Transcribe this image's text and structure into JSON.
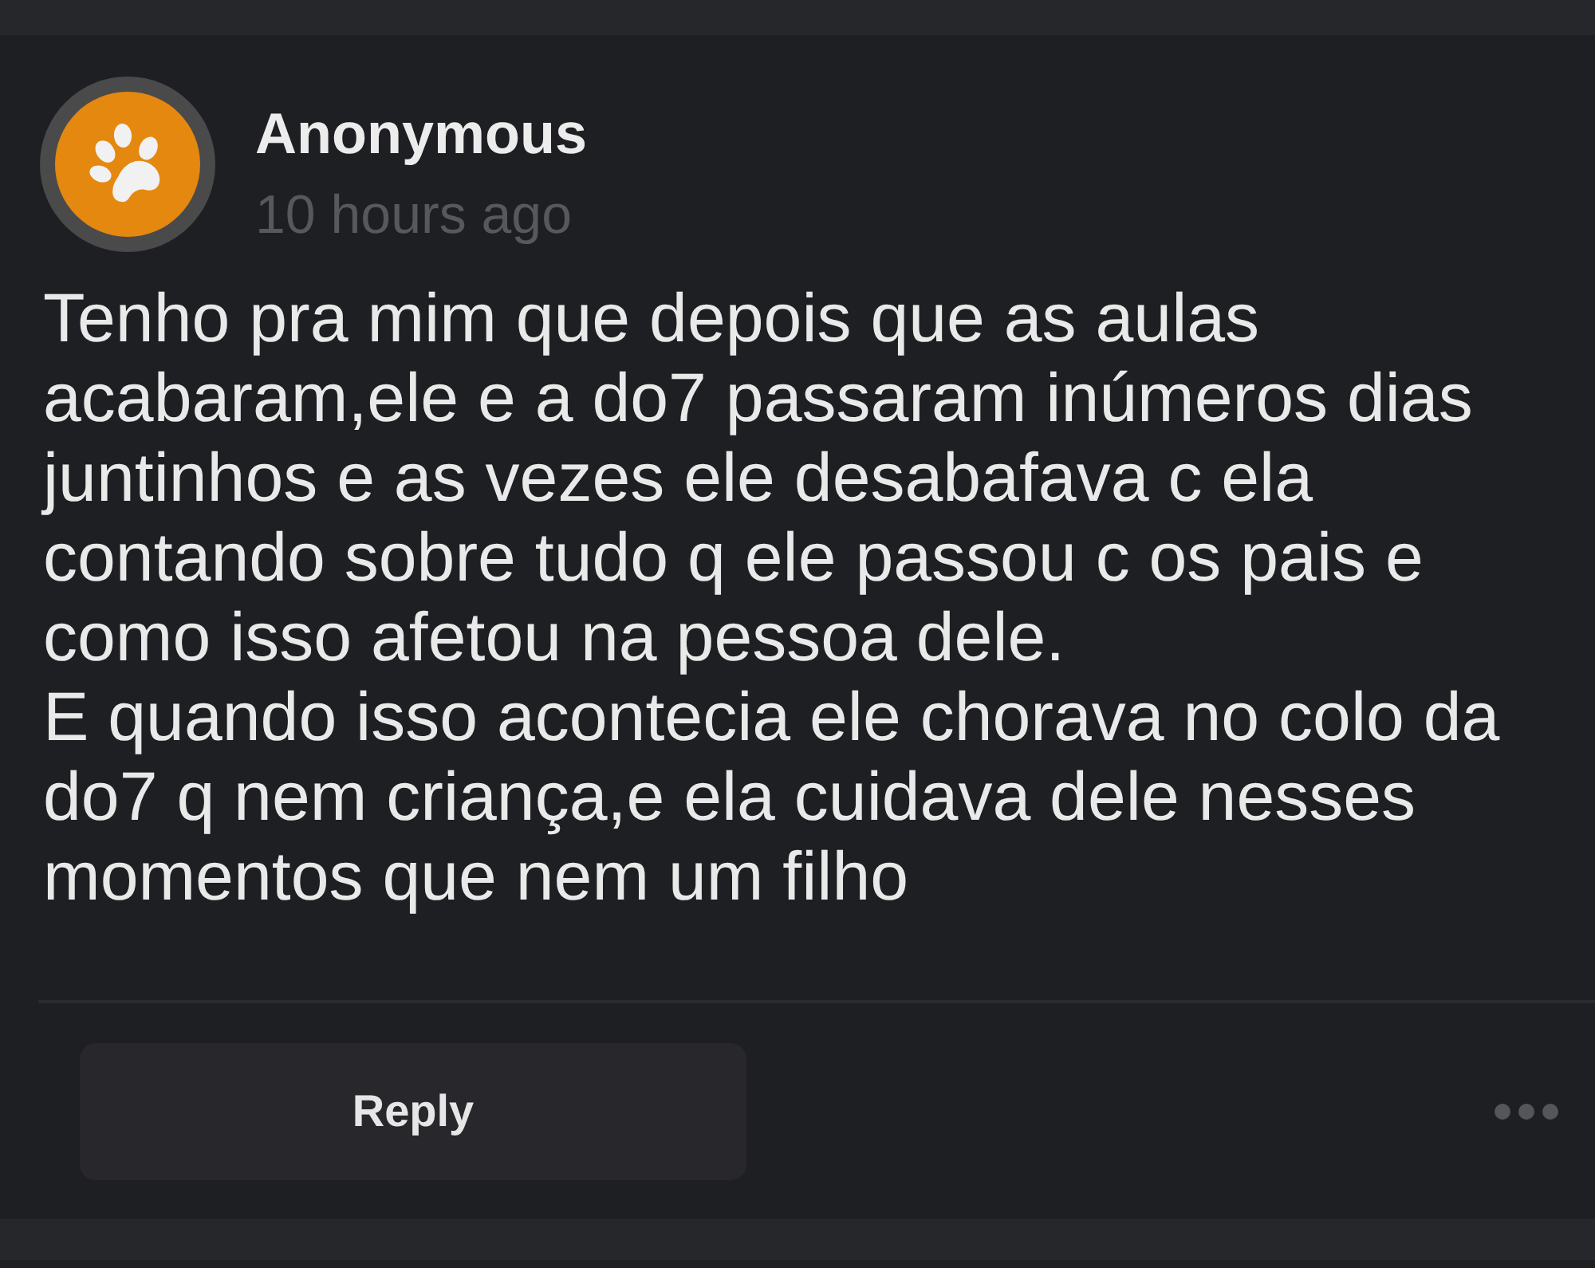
{
  "post": {
    "author": "Anonymous",
    "time": "10 hours ago",
    "body": "Tenho pra mim que depois que as aulas acabaram,ele e a do7 passaram inúmeros dias juntinhos e as vezes ele desabafava c ela contando sobre tudo q ele passou c os pais e como isso afetou na pessoa dele.\nE quando isso acontecia ele chorava no colo da do7 q nem criança,e ela cuidava dele nesses momentos que nem um filho"
  },
  "actions": {
    "reply": "Reply"
  }
}
